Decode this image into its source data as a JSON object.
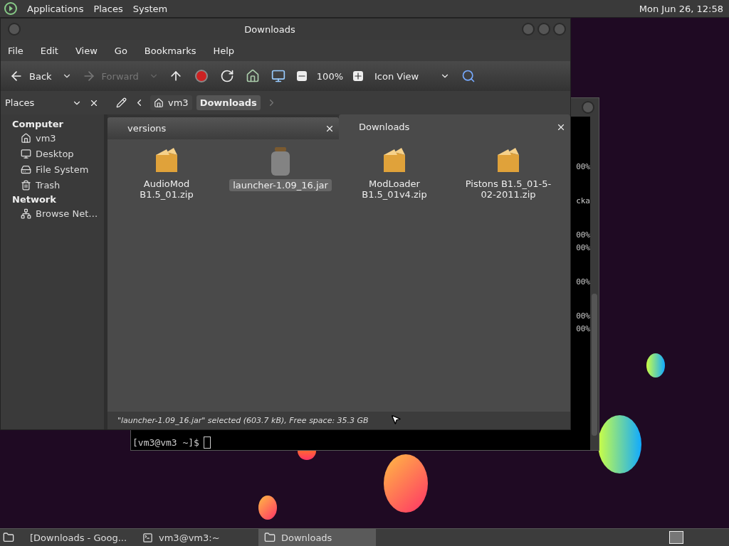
{
  "top_panel": {
    "menus": [
      "Applications",
      "Places",
      "System"
    ],
    "clock": "Mon Jun 26, 12:58"
  },
  "terminal": {
    "output_blocks": [
      [
        "00%"
      ],
      [
        "cka"
      ],
      [
        "00%",
        "00%"
      ],
      [
        "00%"
      ],
      [
        "00%",
        "00%"
      ]
    ],
    "prompt": "[vm3@vm3 ~]$"
  },
  "window": {
    "title": "Downloads"
  },
  "menu_bar": [
    "File",
    "Edit",
    "View",
    "Go",
    "Bookmarks",
    "Help"
  ],
  "toolbar": {
    "back": {
      "label": "Back",
      "disabled": false
    },
    "forward": {
      "label": "Forward",
      "disabled": true
    },
    "zoom": "100%",
    "view_mode": "Icon View"
  },
  "location_bar": {
    "pane": "Places",
    "path": [
      {
        "label": "vm3",
        "kind": "home",
        "selected": false
      },
      {
        "label": "Downloads",
        "kind": "folder",
        "selected": true
      }
    ]
  },
  "sidebar": {
    "groups": [
      {
        "title": "Computer",
        "items": [
          {
            "label": "vm3",
            "kind": "home"
          },
          {
            "label": "Desktop",
            "kind": "desktop"
          },
          {
            "label": "File System",
            "kind": "drive"
          },
          {
            "label": "Trash",
            "kind": "trash"
          }
        ]
      },
      {
        "title": "Network",
        "items": [
          {
            "label": "Browse Net…",
            "kind": "network"
          }
        ]
      }
    ]
  },
  "tabs": [
    {
      "label": "versions",
      "selected": false
    },
    {
      "label": "Downloads",
      "selected": true
    }
  ],
  "files": [
    {
      "name": "AudioMod B1.5_01.zip",
      "kind": "zip",
      "selected": false
    },
    {
      "name": "launcher-1.09_16.jar",
      "kind": "jar",
      "selected": true
    },
    {
      "name": "ModLoader B1.5_01v4.zip",
      "kind": "zip",
      "selected": false
    },
    {
      "name": "Pistons B1.5_01-5-02-2011.zip",
      "kind": "zip",
      "selected": false
    }
  ],
  "status_bar": "\"launcher-1.09_16.jar\" selected (603.7 kB), Free space: 35.3 GB",
  "taskbar": [
    {
      "label": "[Downloads - Goog...",
      "kind": "browser",
      "selected": false
    },
    {
      "label": "vm3@vm3:~",
      "kind": "terminal",
      "selected": false
    },
    {
      "label": "Downloads",
      "kind": "folder",
      "selected": true
    }
  ]
}
